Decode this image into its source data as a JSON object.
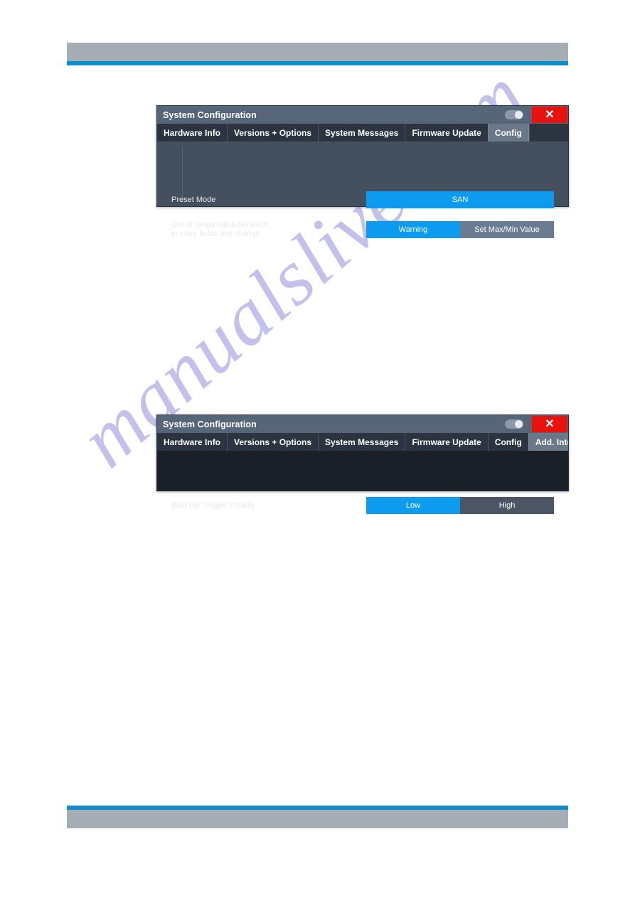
{
  "page": {
    "header_rule_color": "#a6adb4",
    "accent_color": "#0e8ccb",
    "watermark_text": "manualslive.com"
  },
  "dialogs": [
    {
      "id": "config",
      "title": "System Configuration",
      "titlebar": {
        "toggle_state": "on",
        "close_label": "✕"
      },
      "tabs": [
        {
          "label": "Hardware Info",
          "selected": false
        },
        {
          "label": "Versions + Options",
          "selected": false
        },
        {
          "label": "System Messages",
          "selected": false
        },
        {
          "label": "Firmware Update",
          "selected": false
        },
        {
          "label": "Config",
          "selected": true
        }
      ],
      "rows": [
        {
          "label": "Preset Mode",
          "segments": [
            {
              "label": "SAN",
              "active": true
            }
          ]
        },
        {
          "label": "Out of range value behavior\nin entry fields and dialogs",
          "segments": [
            {
              "label": "Warning",
              "active": true
            },
            {
              "label": "Set Max/Min Value",
              "active": false
            }
          ]
        }
      ]
    },
    {
      "id": "addif",
      "title": "System Configuration",
      "titlebar": {
        "toggle_state": "on",
        "close_label": "✕"
      },
      "tabs": [
        {
          "label": "Hardware Info",
          "selected": false
        },
        {
          "label": "Versions + Options",
          "selected": false
        },
        {
          "label": "System Messages",
          "selected": false
        },
        {
          "label": "Firmware Update",
          "selected": false
        },
        {
          "label": "Config",
          "selected": false
        },
        {
          "label": "Add. Interfaces",
          "selected": true
        }
      ],
      "rows": [
        {
          "label": "Wait For Trigger Polarity",
          "segments": [
            {
              "label": "Low",
              "active": true
            },
            {
              "label": "High",
              "active": false
            }
          ]
        }
      ]
    }
  ]
}
